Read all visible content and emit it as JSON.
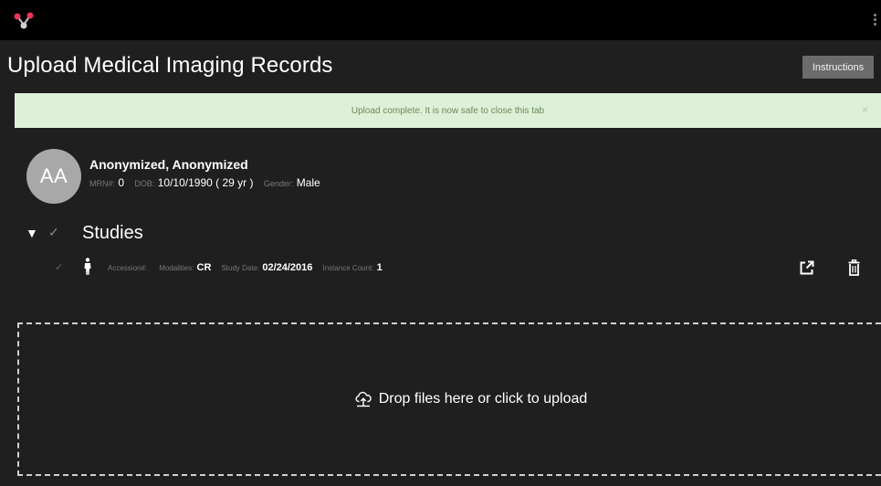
{
  "header": {
    "title": "Upload Medical Imaging Records",
    "instructions_label": "Instructions",
    "logo_icon": "molecule-logo",
    "menu_icon": "kebab-menu-icon",
    "logo_color": "#e8385a"
  },
  "alert": {
    "message": "Upload complete. It is now safe to close this tab",
    "close_symbol": "×",
    "bg_color": "#dff0d8"
  },
  "patient": {
    "initials": "AA",
    "name": "Anonymized, Anonymized",
    "mrn_label": "MRN#:",
    "mrn": "0",
    "dob_label": "DOB:",
    "dob": "10/10/1990 ( 29 yr )",
    "gender_label": "Gender:",
    "gender": "Male"
  },
  "studies": {
    "toggle_symbol": "▼",
    "check_symbol": "✓",
    "label": "Studies",
    "items": [
      {
        "check_symbol": "✓",
        "accession_label": "Accession#:",
        "accession": "",
        "modalities_label": "Modalities:",
        "modalities": "CR",
        "study_date_label": "Study Date:",
        "study_date": "02/24/2016",
        "instance_count_label": "Instance Count:",
        "instance_count": "1"
      }
    ]
  },
  "dropzone": {
    "text": "Drop files here or click to upload",
    "icon": "upload-cloud-icon"
  }
}
